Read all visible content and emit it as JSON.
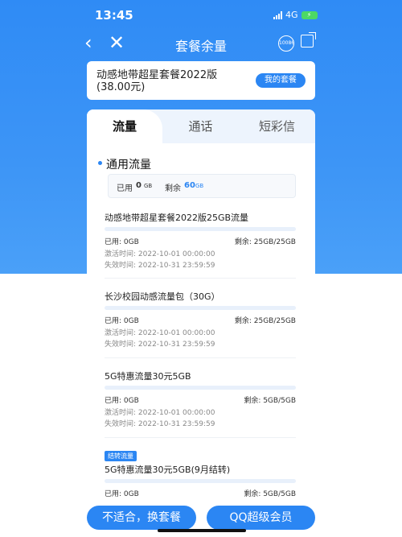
{
  "status": {
    "time": "13:45",
    "network": "4G"
  },
  "nav": {
    "title": "套餐余量",
    "service": "10086"
  },
  "package": {
    "name": "动感地带超星套餐2022版(38.00元)",
    "button": "我的套餐"
  },
  "tabs": [
    {
      "label": "流量"
    },
    {
      "label": "通话"
    },
    {
      "label": "短彩信"
    }
  ],
  "section": {
    "title": "通用流量",
    "used_label": "已用",
    "used_value": "0",
    "used_unit": "GB",
    "remain_label": "剩余",
    "remain_value": "60",
    "remain_unit": "GB"
  },
  "items": [
    {
      "tag": "",
      "title": "动感地带超星套餐2022版25GB流量",
      "progress": 0.0,
      "used": "已用: 0GB",
      "remain": "剩余: 25GB/25GB",
      "activate": "激活时间: 2022-10-01 00:00:00",
      "expire": "失效时间: 2022-10-31 23:59:59"
    },
    {
      "tag": "",
      "title": "长沙校园动感流量包（30G）",
      "progress": 0.0,
      "used": "已用: 0GB",
      "remain": "剩余: 25GB/25GB",
      "activate": "激活时间: 2022-10-01 00:00:00",
      "expire": "失效时间: 2022-10-31 23:59:59"
    },
    {
      "tag": "",
      "title": "5G特惠流量30元5GB",
      "progress": 0.0,
      "used": "已用: 0GB",
      "remain": "剩余: 5GB/5GB",
      "activate": "激活时间: 2022-10-01 00:00:00",
      "expire": "失效时间: 2022-10-31 23:59:59"
    },
    {
      "tag": "结转流量",
      "title": "5G特惠流量30元5GB(9月结转)",
      "progress": 0.0,
      "used": "已用: 0GB",
      "remain": "剩余: 5GB/5GB",
      "activate": "",
      "expire": ""
    }
  ],
  "bottom": {
    "change_plan": "不适合，换套餐",
    "qq_vip": "QQ超级会员"
  },
  "colors": {
    "primary": "#2b86f3",
    "battery": "#4cd964"
  }
}
